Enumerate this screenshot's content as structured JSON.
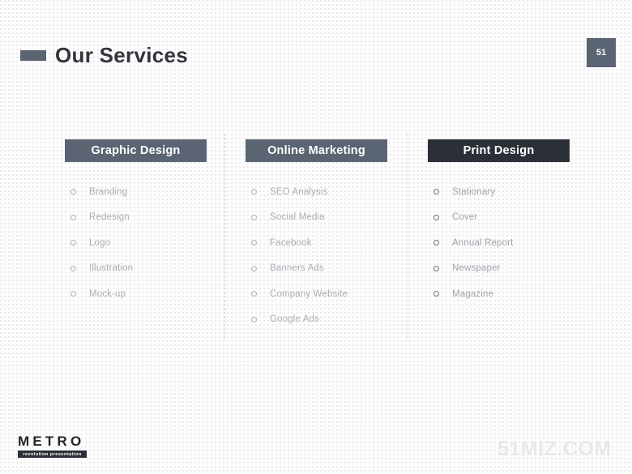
{
  "slide": {
    "title": "Our Services",
    "page_number": "51",
    "background_color": "#fdfdfd",
    "accent_color": "#5b6472",
    "dark_accent_color": "#2b3038",
    "title_color": "#32363c",
    "item_text_color": "#a9adb3"
  },
  "columns": [
    {
      "header": "Graphic Design",
      "header_color": "#5b6472",
      "bullet_icon": "circle-outline-icon",
      "items": [
        "Branding",
        "Redesign",
        "Logo",
        "Illustration",
        "Mock-up"
      ]
    },
    {
      "header": "Online Marketing",
      "header_color": "#5b6472",
      "bullet_icon": "circle-outline-icon",
      "items": [
        "SEO Analysis",
        "Social Media",
        "Facebook",
        "Banners Ads",
        "Company Website",
        "Google Ads"
      ]
    },
    {
      "header": "Print Design",
      "header_color": "#2b3038",
      "bullet_icon": "circle-outline-icon",
      "items": [
        "Stationary",
        "Cover",
        "Annual Report",
        "Newspaper",
        "Magazine"
      ]
    }
  ],
  "logo": {
    "wordmark": "METRO",
    "tagline": "revolution presentation"
  },
  "watermark": {
    "text": "51MIZ.COM"
  }
}
